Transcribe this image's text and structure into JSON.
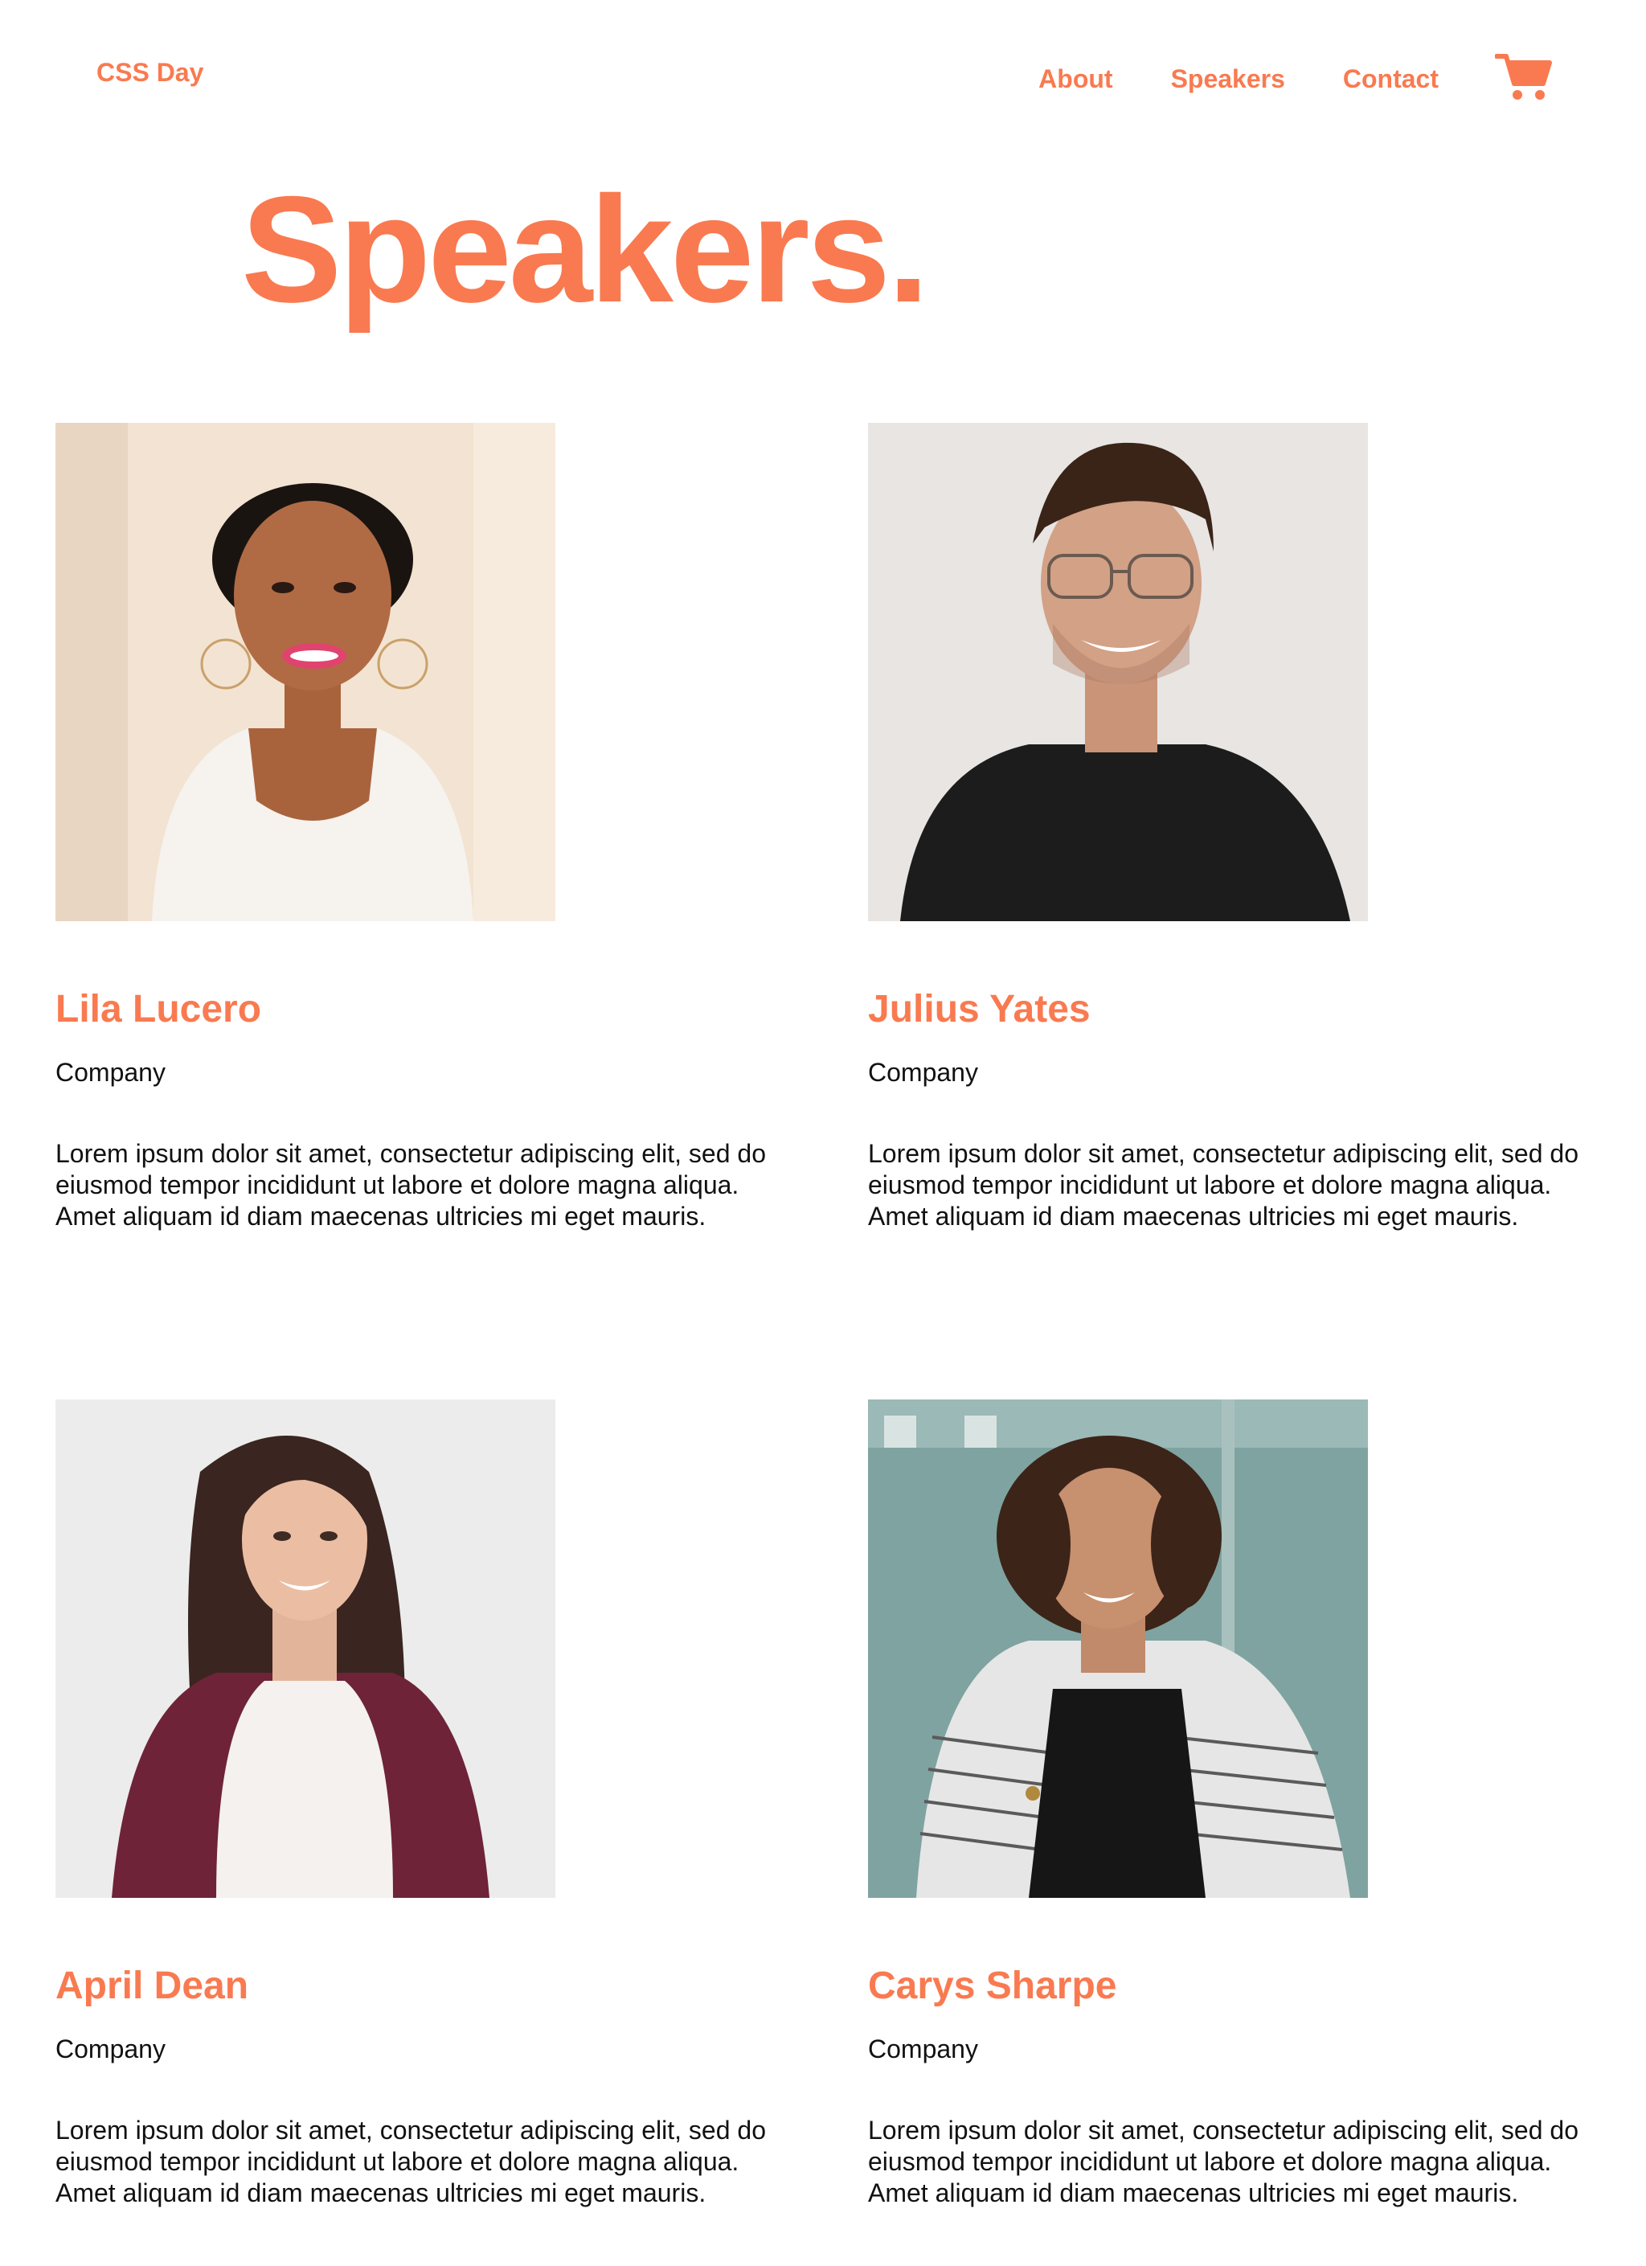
{
  "nav": {
    "brand": "CSS Day",
    "links": [
      {
        "label": "About"
      },
      {
        "label": "Speakers"
      },
      {
        "label": "Contact"
      }
    ],
    "cart_icon": "shopping-cart-icon"
  },
  "page": {
    "title": "Speakers."
  },
  "colors": {
    "accent": "#f97a50",
    "text": "#111111",
    "background": "#ffffff"
  },
  "speakers": [
    {
      "name": "Lila Lucero",
      "company": "Company",
      "bio": "Lorem ipsum dolor sit amet, consectetur adipiscing elit, sed do eiusmod tempor incididunt ut labore et dolore magna aliqua. Amet aliquam id diam maecenas ultricies mi eget mauris."
    },
    {
      "name": "Julius Yates",
      "company": "Company",
      "bio": "Lorem ipsum dolor sit amet, consectetur adipiscing elit, sed do eiusmod tempor incididunt ut labore et dolore magna aliqua. Amet aliquam id diam maecenas ultricies mi eget mauris."
    },
    {
      "name": "April Dean",
      "company": "Company",
      "bio": "Lorem ipsum dolor sit amet, consectetur adipiscing elit, sed do eiusmod tempor incididunt ut labore et dolore magna aliqua. Amet aliquam id diam maecenas ultricies mi eget mauris."
    },
    {
      "name": "Carys Sharpe",
      "company": "Company",
      "bio": "Lorem ipsum dolor sit amet, consectetur adipiscing elit, sed do eiusmod tempor incididunt ut labore et dolore magna aliqua. Amet aliquam id diam maecenas ultricies mi eget mauris."
    }
  ]
}
